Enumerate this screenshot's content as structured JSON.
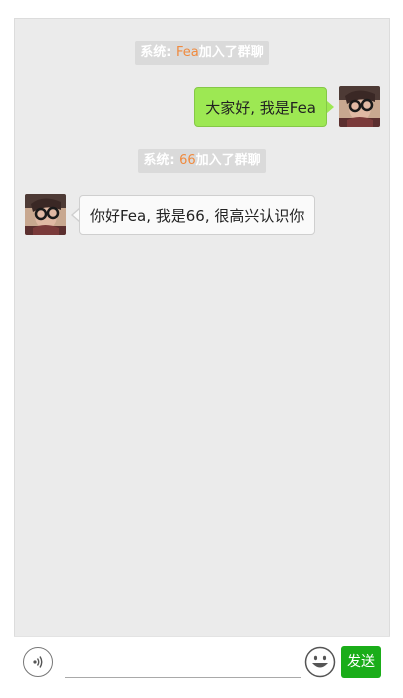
{
  "messages": [
    {
      "type": "system",
      "prefix": "系统: ",
      "name": "Fea",
      "suffix": "加入了群聊"
    },
    {
      "type": "mine",
      "text": "大家好, 我是Fea"
    },
    {
      "type": "system",
      "prefix": "系统: ",
      "name": "66",
      "suffix": "加入了群聊"
    },
    {
      "type": "theirs",
      "text": "你好Fea, 我是66, 很高兴认识你"
    }
  ],
  "input": {
    "send_label": "发送",
    "voice_icon": "voice-icon",
    "emoji_icon": "emoji-icon"
  },
  "colors": {
    "chat_background": "#ebebeb",
    "my_bubble": "#9de853",
    "their_bubble": "#fafafa",
    "system_badge": "#dadada",
    "highlight_name": "#f08a3e",
    "send_button": "#1aad19"
  }
}
